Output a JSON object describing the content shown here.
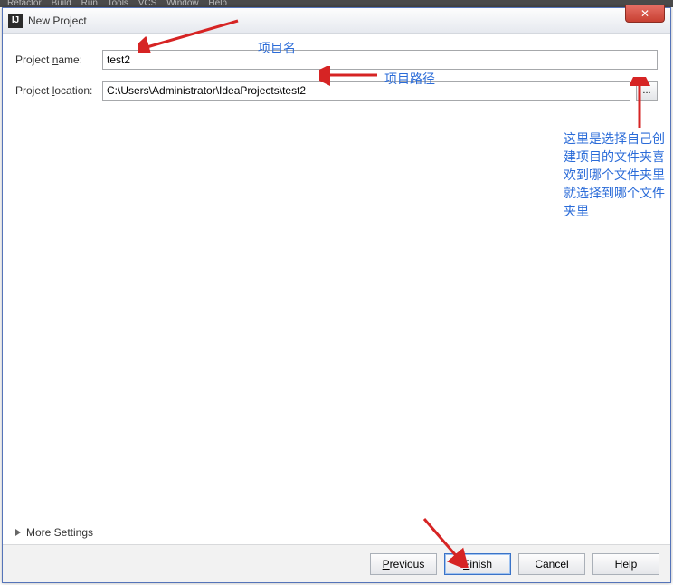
{
  "menubar": {
    "items": [
      "Refactor",
      "Build",
      "Run",
      "Tools",
      "VCS",
      "Window",
      "Help"
    ]
  },
  "dialog": {
    "title": "New Project",
    "close": "✕"
  },
  "form": {
    "name_label_pre": "Project ",
    "name_label_mn": "n",
    "name_label_post": "ame:",
    "name_value": "test2",
    "location_label_pre": "Project ",
    "location_label_mn": "l",
    "location_label_post": "ocation:",
    "location_value": "C:\\Users\\Administrator\\IdeaProjects\\test2",
    "browse": "..."
  },
  "more_settings": "More Settings",
  "buttons": {
    "previous_mn": "P",
    "previous_post": "revious",
    "finish_mn": "F",
    "finish_post": "inish",
    "cancel": "Cancel",
    "help": "Help"
  },
  "annotations": {
    "name_hint": "项目名",
    "path_hint": "项目路径",
    "browse_hint": "这里是选择自己创建项目的文件夹喜欢到哪个文件夹里就选择到哪个文件夹里"
  }
}
